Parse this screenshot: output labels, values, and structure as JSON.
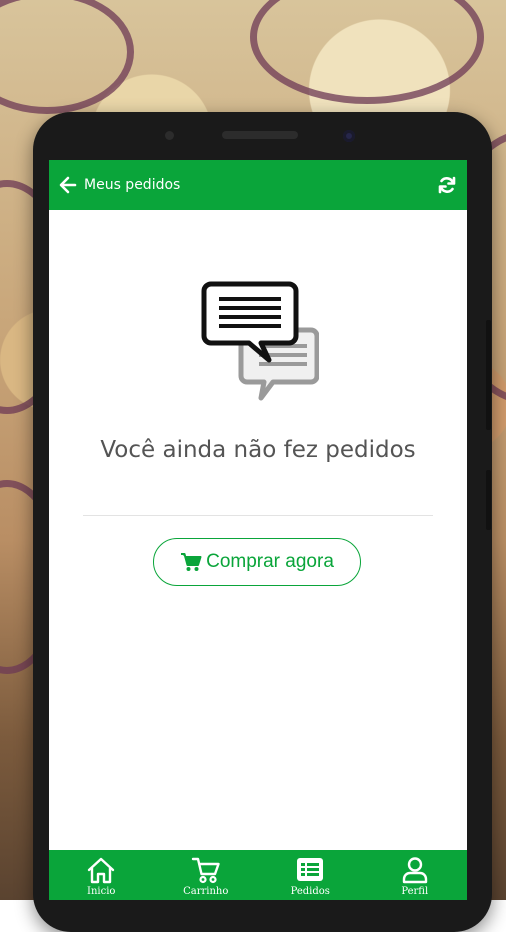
{
  "header": {
    "title": "Meus pedidos"
  },
  "empty_state": {
    "message": "Você ainda não fez pedidos",
    "button_label": "Comprar agora"
  },
  "bottom_nav": {
    "items": [
      {
        "label": "Inicio",
        "icon": "home-icon"
      },
      {
        "label": "Carrinho",
        "icon": "cart-icon"
      },
      {
        "label": "Pedidos",
        "icon": "list-icon"
      },
      {
        "label": "Perfil",
        "icon": "user-icon"
      }
    ]
  },
  "colors": {
    "accent": "#0aa53a",
    "text": "#545454"
  }
}
